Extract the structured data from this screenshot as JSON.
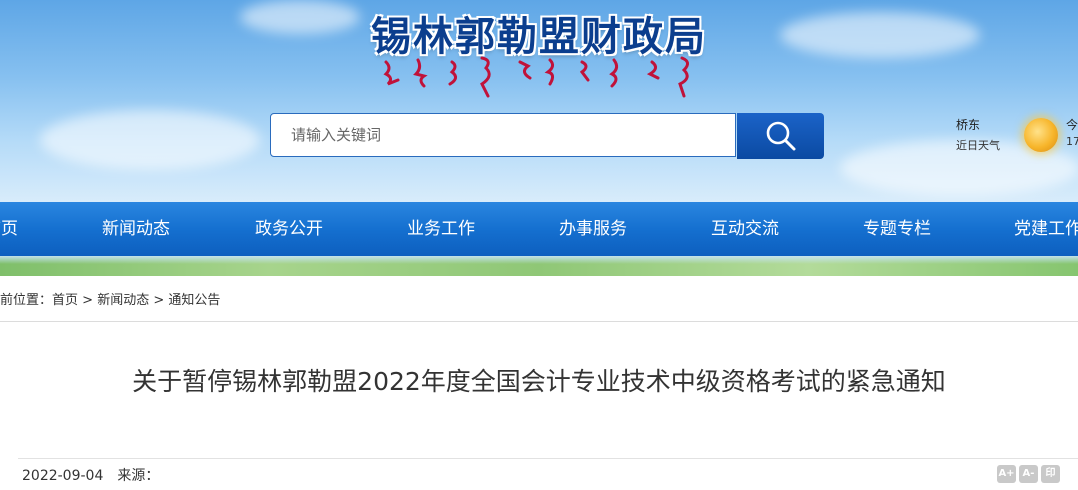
{
  "header": {
    "site_title": "锡林郭勒盟财政局"
  },
  "search": {
    "placeholder": "请输入关键词",
    "button_icon": "search-icon"
  },
  "weather": {
    "city": "桥东",
    "label": "近日天气",
    "today_label": "今",
    "temp": "17",
    "icon": "sun-icon"
  },
  "nav": {
    "items": [
      {
        "label": "首页"
      },
      {
        "label": "新闻动态"
      },
      {
        "label": "政务公开"
      },
      {
        "label": "业务工作"
      },
      {
        "label": "办事服务"
      },
      {
        "label": "互动交流"
      },
      {
        "label": "专题专栏"
      },
      {
        "label": "党建工作"
      }
    ]
  },
  "breadcrumb": {
    "prefix": "当前位置：",
    "home": "首页",
    "sep": ">",
    "level1": "新闻动态",
    "level2": "通知公告"
  },
  "article": {
    "title": "关于暂停锡林郭勒盟2022年度全国会计专业技术中级资格考试的紧急通知",
    "date": "2022-09-04",
    "source_label": "来源："
  },
  "font_tools": {
    "larger": "A+",
    "smaller": "A-",
    "print": "印"
  },
  "colors": {
    "nav_blue": "#1570d0",
    "title_blue": "#0b3e8e",
    "search_button": "#0b4aa2"
  }
}
